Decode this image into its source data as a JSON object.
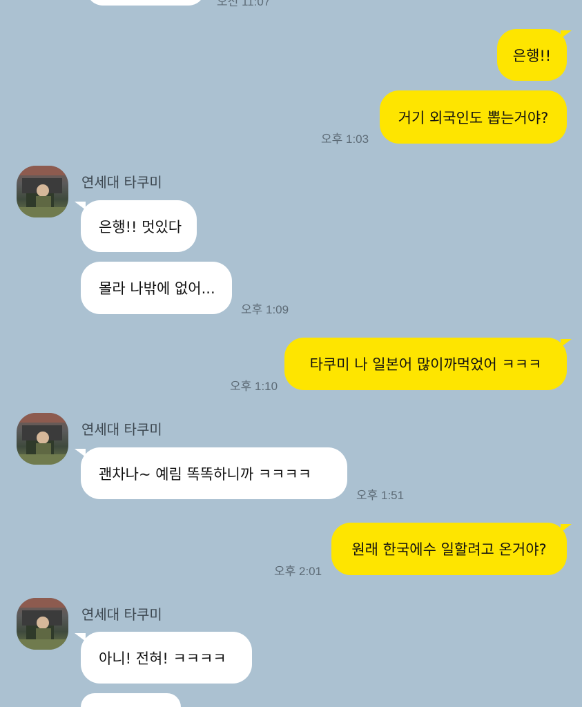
{
  "chat": {
    "top_partial_time": "오전 11:07",
    "messages": [
      {
        "text": "은행!!"
      },
      {
        "text": "거기 외국인도 뽑는거야?",
        "time": "오후 1:03"
      },
      {
        "sender": "연세대 타쿠미"
      },
      {
        "text": "은행!! 멋있다"
      },
      {
        "text": "몰라 나밖에 없어...",
        "time": "오후 1:09"
      },
      {
        "text": "타쿠미 나 일본어 많이까먹었어 ㅋㅋㅋ",
        "time": "오후 1:10"
      },
      {
        "sender": "연세대 타쿠미"
      },
      {
        "text": "괜차나~ 예림 똑똑하니까 ㅋㅋㅋㅋ",
        "time": "오후 1:51"
      },
      {
        "text": "원래 한국에수 일할려고 온거야?",
        "time": "오후 2:01"
      },
      {
        "sender": "연세대 타쿠미"
      },
      {
        "text": "아니! 전혀! ㅋㅋㅋㅋ"
      }
    ]
  },
  "colors": {
    "background": "#abc1d1",
    "my_bubble": "#fee500",
    "their_bubble": "#ffffff"
  },
  "icons": {
    "avatar": "profile-photo-avatar"
  }
}
